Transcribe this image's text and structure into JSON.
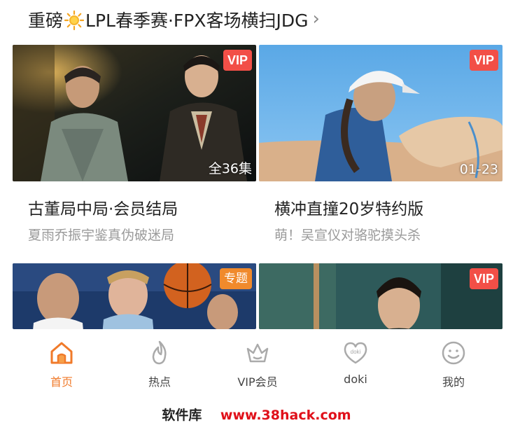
{
  "header": {
    "title_before": "重磅",
    "title_after": "LPL春季赛·FPX客场横扫JDG",
    "icon": "sun-icon",
    "chevron": "chevron-right-icon"
  },
  "cards": [
    {
      "badge": "VIP",
      "corner": "全36集",
      "title": "古董局中局·会员结局",
      "subtitle": "夏雨乔振宇鉴真伪破迷局"
    },
    {
      "badge": "VIP",
      "corner": "01-23",
      "title": "横冲直撞20岁特约版",
      "subtitle": "萌！吴宣仪对骆驼摸头杀"
    },
    {
      "badge": "专题",
      "corner": "",
      "title": "",
      "subtitle": ""
    },
    {
      "badge": "VIP",
      "corner": "",
      "title": "",
      "subtitle": ""
    }
  ],
  "tabs": [
    {
      "label": "首页",
      "icon": "home-icon",
      "active": true
    },
    {
      "label": "热点",
      "icon": "flame-icon",
      "active": false
    },
    {
      "label": "VIP会员",
      "icon": "vip-crown-icon",
      "active": false
    },
    {
      "label": "doki",
      "icon": "doki-heart-icon",
      "active": false
    },
    {
      "label": "我的",
      "icon": "smiley-face-icon",
      "active": false
    }
  ],
  "watermark": {
    "left": "软件库",
    "right": "www.38hack.com"
  },
  "colors": {
    "accent": "#f07a2a",
    "vip_badge": "#f24f47",
    "topic_badge": "#f08a2c"
  }
}
